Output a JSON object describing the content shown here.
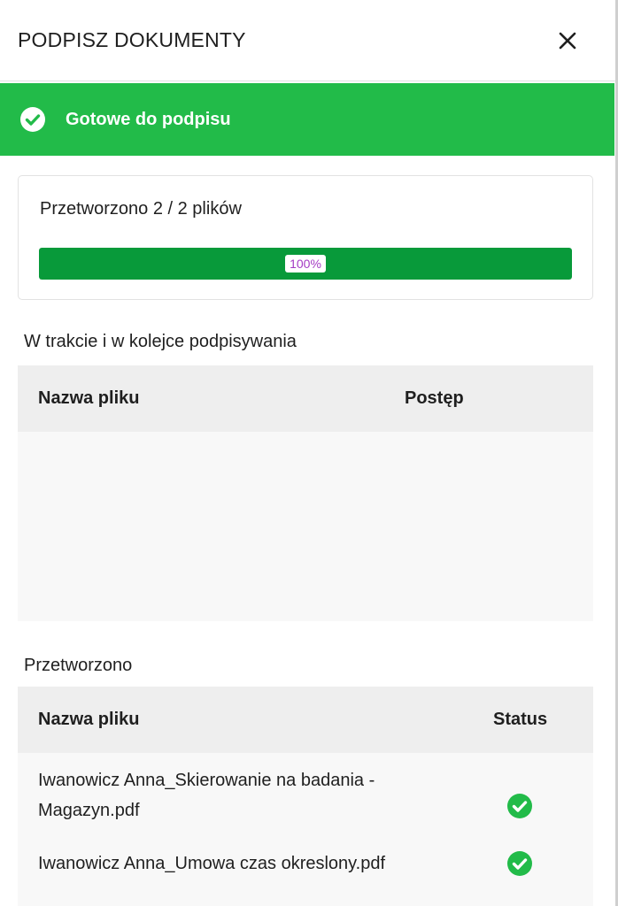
{
  "dialog": {
    "title": "PODPISZ DOKUMENTY",
    "close_icon": "close-icon"
  },
  "banner": {
    "icon": "check-circle-icon",
    "text": "Gotowe do podpisu",
    "color": "#22bb49"
  },
  "progress": {
    "text": "Przetworzono 2 / 2 plików",
    "percent": 100,
    "percent_label": "100%",
    "fill_color": "#089a3a"
  },
  "in_progress": {
    "title": "W trakcie i w kolejce podpisywania",
    "columns": [
      "Nazwa pliku",
      "Postęp"
    ],
    "rows": []
  },
  "processed": {
    "title": "Przetworzono",
    "columns": [
      "Nazwa pliku",
      "Status"
    ],
    "rows": [
      {
        "name": "Iwanowicz Anna_Skierowanie na badania - Magazyn.pdf",
        "status_icon": "check-circle-icon"
      },
      {
        "name": "Iwanowicz Anna_Umowa czas okreslony.pdf",
        "status_icon": "check-circle-icon"
      }
    ]
  }
}
